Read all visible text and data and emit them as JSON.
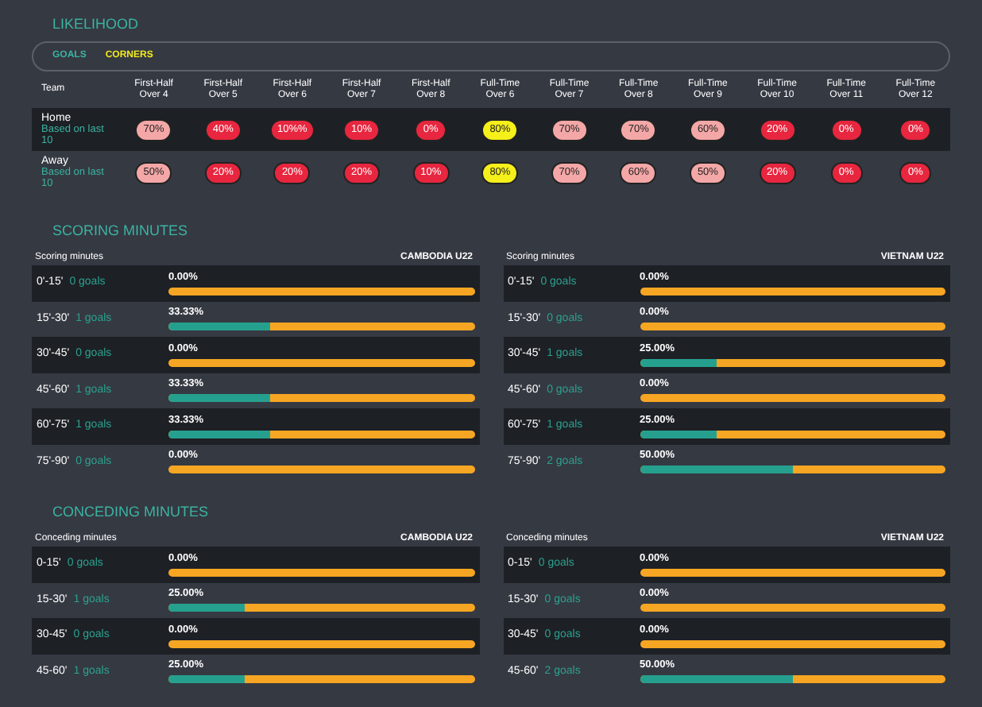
{
  "likelihood": {
    "title": "LIKELIHOOD",
    "tabs": [
      {
        "label": "GOALS",
        "selected": false
      },
      {
        "label": "CORNERS",
        "selected": true
      }
    ],
    "team_header": "Team",
    "columns": [
      "First-Half Over 4",
      "First-Half Over 5",
      "First-Half Over 6",
      "First-Half Over 7",
      "First-Half Over 8",
      "Full-Time Over 6",
      "Full-Time Over 7",
      "Full-Time Over 8",
      "Full-Time Over 9",
      "Full-Time Over 10",
      "Full-Time Over 11",
      "Full-Time Over 12"
    ],
    "rows": [
      {
        "team": "Home",
        "note": "Based on last 10",
        "cells": [
          {
            "value": "70%",
            "color": "#f4a7a7"
          },
          {
            "value": "40%",
            "color": "#e8263f"
          },
          {
            "value": "10%%",
            "color": "#e8263f"
          },
          {
            "value": "10%",
            "color": "#e8263f"
          },
          {
            "value": "0%",
            "color": "#e8263f"
          },
          {
            "value": "80%",
            "color": "#f5ef1a"
          },
          {
            "value": "70%",
            "color": "#f4a7a7"
          },
          {
            "value": "70%",
            "color": "#f4a7a7"
          },
          {
            "value": "60%",
            "color": "#f4a7a7"
          },
          {
            "value": "20%",
            "color": "#e8263f"
          },
          {
            "value": "0%",
            "color": "#e8263f"
          },
          {
            "value": "0%",
            "color": "#e8263f"
          }
        ]
      },
      {
        "team": "Away",
        "note": "Based on last 10",
        "cells": [
          {
            "value": "50%",
            "color": "#f4a7a7"
          },
          {
            "value": "20%",
            "color": "#e8263f"
          },
          {
            "value": "20%",
            "color": "#e8263f"
          },
          {
            "value": "20%",
            "color": "#e8263f"
          },
          {
            "value": "10%",
            "color": "#e8263f"
          },
          {
            "value": "80%",
            "color": "#f5ef1a"
          },
          {
            "value": "70%",
            "color": "#f4a7a7"
          },
          {
            "value": "60%",
            "color": "#f4a7a7"
          },
          {
            "value": "50%",
            "color": "#f4a7a7"
          },
          {
            "value": "20%",
            "color": "#e8263f"
          },
          {
            "value": "0%",
            "color": "#e8263f"
          },
          {
            "value": "0%",
            "color": "#e8263f"
          }
        ]
      }
    ]
  },
  "sections": [
    {
      "title": "SCORING MINUTES",
      "panels": [
        {
          "header": "Scoring minutes",
          "team": "CAMBODIA U22",
          "rows": [
            {
              "minutes": "0'-15'",
              "goals": "0 goals",
              "percent": "0.00%",
              "level": 0
            },
            {
              "minutes": "15'-30'",
              "goals": "1 goals",
              "percent": "33.33%",
              "level": 0.3333
            },
            {
              "minutes": "30'-45'",
              "goals": "0 goals",
              "percent": "0.00%",
              "level": 0
            },
            {
              "minutes": "45'-60'",
              "goals": "1 goals",
              "percent": "33.33%",
              "level": 0.3333
            },
            {
              "minutes": "60'-75'",
              "goals": "1 goals",
              "percent": "33.33%",
              "level": 0.3333
            },
            {
              "minutes": "75'-90'",
              "goals": "0 goals",
              "percent": "0.00%",
              "level": 0
            }
          ]
        },
        {
          "header": "Scoring minutes",
          "team": "VIETNAM U22",
          "rows": [
            {
              "minutes": "0'-15'",
              "goals": "0 goals",
              "percent": "0.00%",
              "level": 0
            },
            {
              "minutes": "15'-30'",
              "goals": "0 goals",
              "percent": "0.00%",
              "level": 0
            },
            {
              "minutes": "30'-45'",
              "goals": "1 goals",
              "percent": "25.00%",
              "level": 0.25
            },
            {
              "minutes": "45'-60'",
              "goals": "0 goals",
              "percent": "0.00%",
              "level": 0
            },
            {
              "minutes": "60'-75'",
              "goals": "1 goals",
              "percent": "25.00%",
              "level": 0.25
            },
            {
              "minutes": "75'-90'",
              "goals": "2 goals",
              "percent": "50.00%",
              "level": 0.5
            }
          ]
        }
      ]
    },
    {
      "title": "CONCEDING MINUTES",
      "panels": [
        {
          "header": "Conceding minutes",
          "team": "CAMBODIA U22",
          "rows": [
            {
              "minutes": "0-15'",
              "goals": "0 goals",
              "percent": "0.00%",
              "level": 0
            },
            {
              "minutes": "15-30'",
              "goals": "1 goals",
              "percent": "25.00%",
              "level": 0.25
            },
            {
              "minutes": "30-45'",
              "goals": "0 goals",
              "percent": "0.00%",
              "level": 0
            },
            {
              "minutes": "45-60'",
              "goals": "1 goals",
              "percent": "25.00%",
              "level": 0.25
            }
          ]
        },
        {
          "header": "Conceding minutes",
          "team": "VIETNAM U22",
          "rows": [
            {
              "minutes": "0-15'",
              "goals": "0 goals",
              "percent": "0.00%",
              "level": 0
            },
            {
              "minutes": "15-30'",
              "goals": "0 goals",
              "percent": "0.00%",
              "level": 0
            },
            {
              "minutes": "30-45'",
              "goals": "0 goals",
              "percent": "0.00%",
              "level": 0
            },
            {
              "minutes": "45-60'",
              "goals": "2 goals",
              "percent": "50.00%",
              "level": 0.5
            }
          ]
        }
      ]
    }
  ]
}
